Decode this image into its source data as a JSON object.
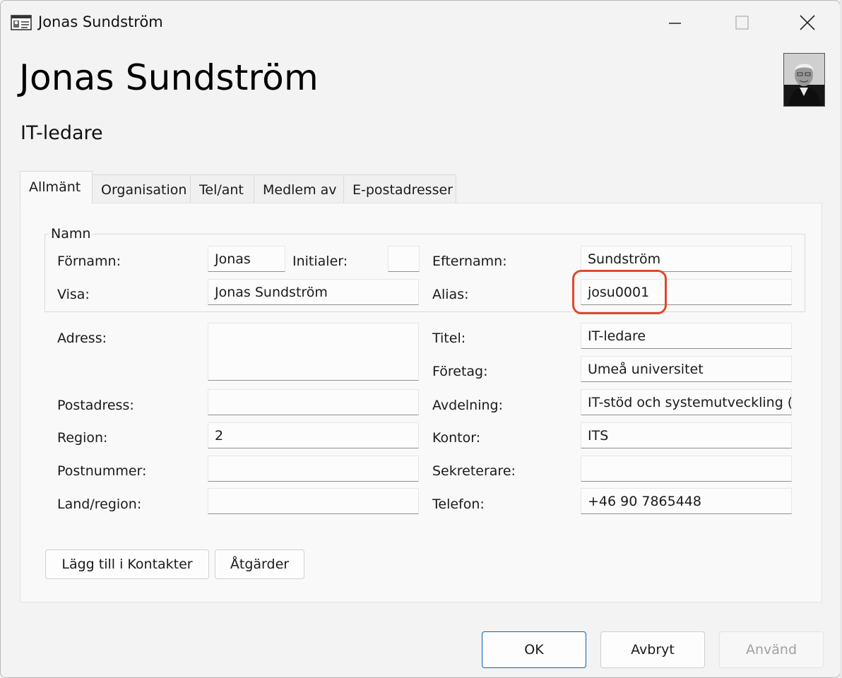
{
  "window": {
    "title": "Jonas Sundström"
  },
  "header": {
    "display_name": "Jonas Sundström",
    "job_title": "IT-ledare"
  },
  "tabs": [
    {
      "label": "Allmänt",
      "active": true
    },
    {
      "label": "Organisation",
      "active": false
    },
    {
      "label": "Tel/ant",
      "active": false
    },
    {
      "label": "Medlem av",
      "active": false
    },
    {
      "label": "E-postadresser",
      "active": false
    }
  ],
  "name_group": {
    "legend": "Namn",
    "first_name": {
      "label": "Förnamn:",
      "value": "Jonas"
    },
    "initials": {
      "label": "Initialer:",
      "value": ""
    },
    "last_name": {
      "label": "Efternamn:",
      "value": "Sundström"
    },
    "display": {
      "label": "Visa:",
      "value": "Jonas Sundström"
    },
    "alias": {
      "label": "Alias:",
      "value": "josu0001"
    }
  },
  "left_fields": {
    "address": {
      "label": "Adress:",
      "value": ""
    },
    "postal_address": {
      "label": "Postadress:",
      "value": ""
    },
    "region": {
      "label": "Region:",
      "value": "2"
    },
    "postal_code": {
      "label": "Postnummer:",
      "value": ""
    },
    "country": {
      "label": "Land/region:",
      "value": ""
    }
  },
  "right_fields": {
    "title": {
      "label": "Titel:",
      "value": "IT-ledare"
    },
    "company": {
      "label": "Företag:",
      "value": "Umeå universitet"
    },
    "department": {
      "label": "Avdelning:",
      "value": "IT-stöd och systemutveckling (I"
    },
    "office": {
      "label": "Kontor:",
      "value": "ITS"
    },
    "assistant": {
      "label": "Sekreterare:",
      "value": ""
    },
    "phone": {
      "label": "Telefon:",
      "value": "+46 90 7865448"
    }
  },
  "actions": {
    "add_contacts": "Lägg till i Kontakter",
    "actions": "Åtgärder"
  },
  "dialog_buttons": {
    "ok": "OK",
    "cancel": "Avbryt",
    "apply": "Använd"
  },
  "colors": {
    "highlight": "#e0482d",
    "primary_border": "#0067c0"
  }
}
